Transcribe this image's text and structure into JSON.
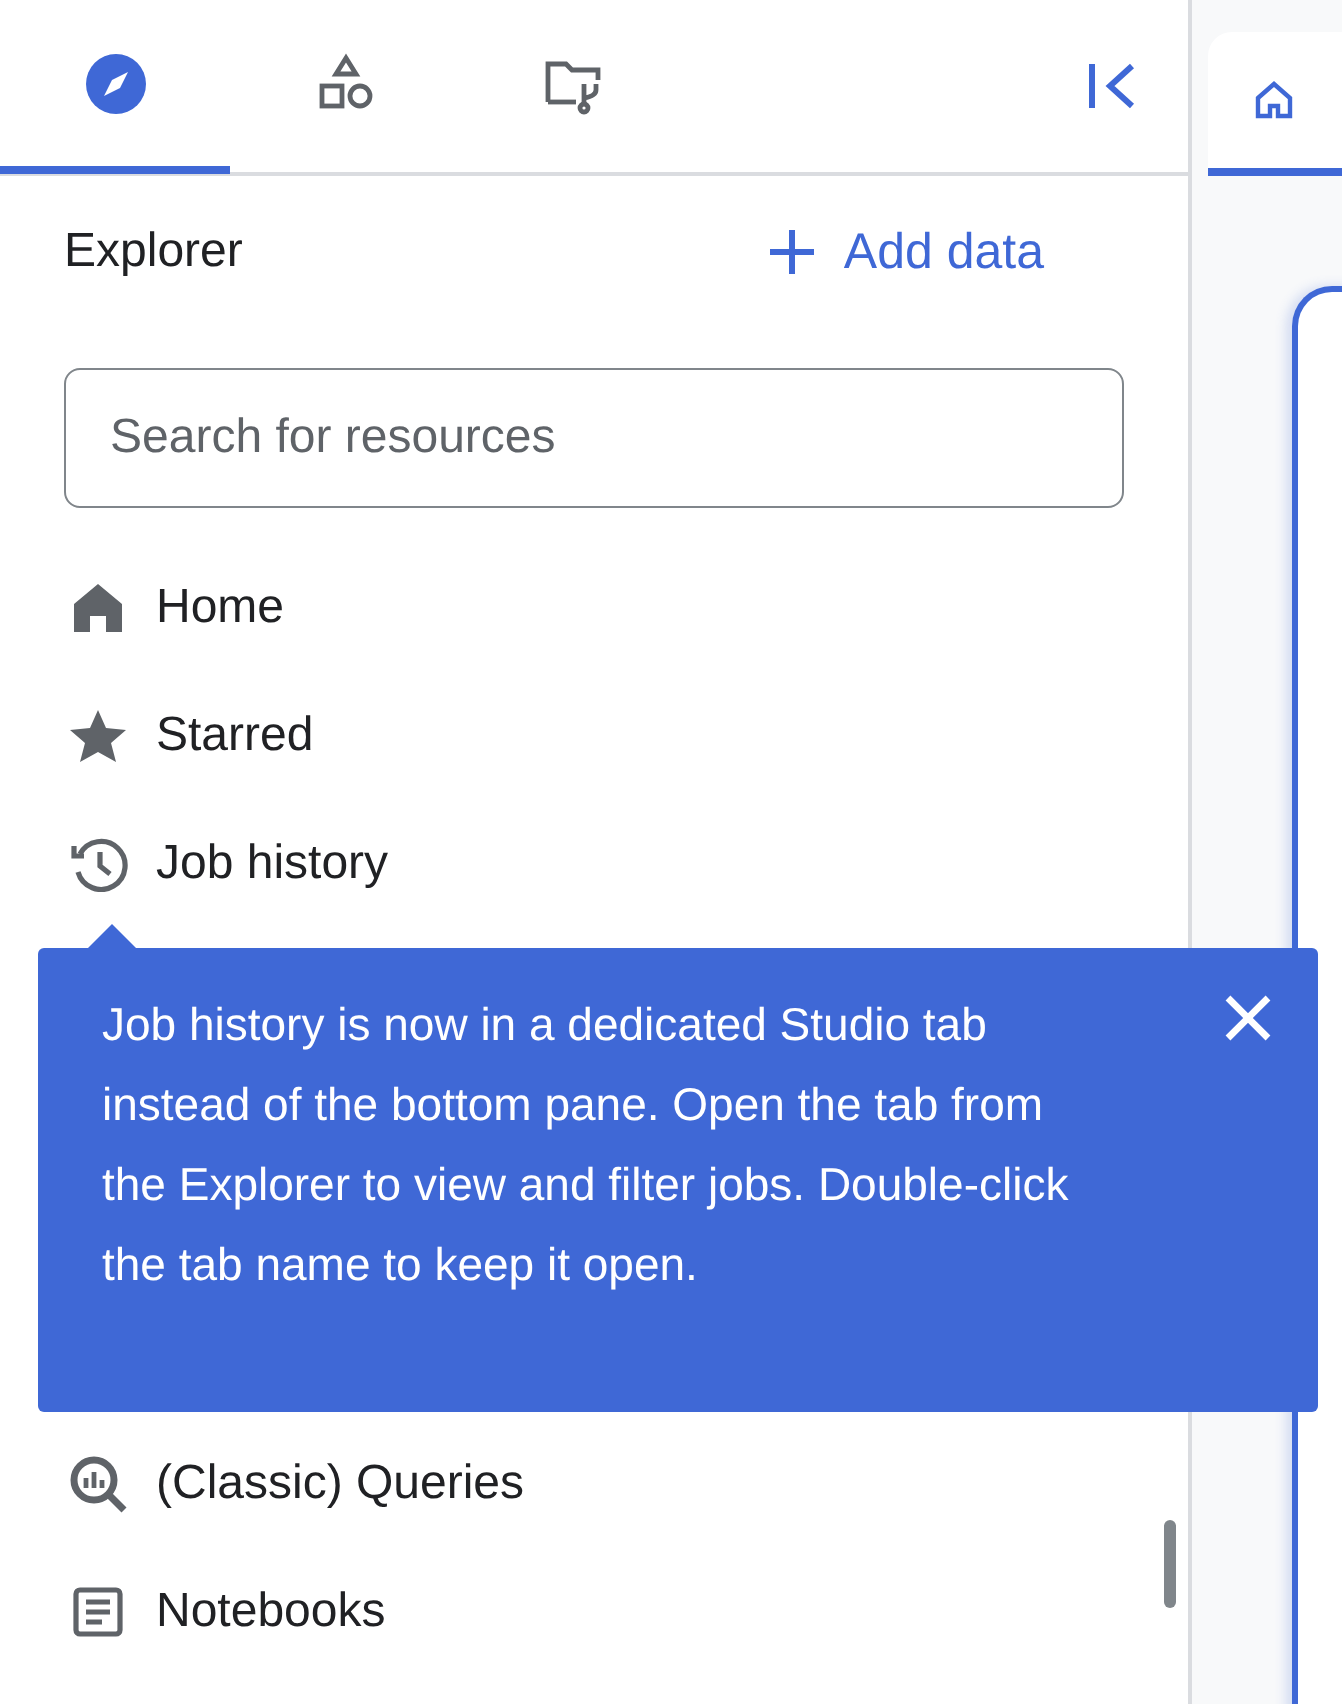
{
  "panel_tabs": [
    {
      "selected": true
    },
    {
      "selected": false
    },
    {
      "selected": false
    }
  ],
  "explorer": {
    "title": "Explorer",
    "add_button": "Add data",
    "search": {
      "placeholder": "Search for resources"
    }
  },
  "nav_items": [
    {
      "label": "Home"
    },
    {
      "label": "Starred"
    },
    {
      "label": "Job history"
    }
  ],
  "nav_items_below": [
    {
      "label": "(Classic) Queries"
    },
    {
      "label": "Notebooks"
    }
  ],
  "editor_tabs": [
    {
      "selected": true
    }
  ],
  "tooltip": {
    "text": "Job history is now in a dedicated Studio tab instead of the bottom pane. Open the tab from the Explorer to view and filter jobs. Double-click the tab name to keep it open."
  }
}
